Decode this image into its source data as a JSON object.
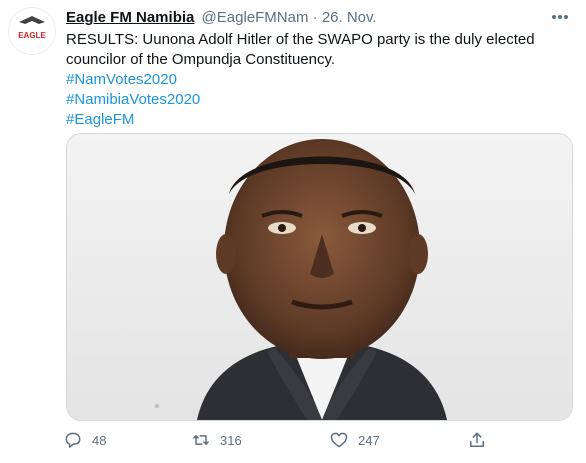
{
  "tweet": {
    "avatar_text": "EAGLE",
    "display_name": "Eagle FM Namibia",
    "handle": "@EagleFMNam",
    "separator": "·",
    "timestamp": "26. Nov.",
    "text_line": "RESULTS: Uunona Adolf Hitler of the SWAPO party is the duly elected councilor of the Ompundja Constituency.",
    "hashtags": [
      "#NamVotes2020",
      "#NamibiaVotes2020",
      "#EagleFM"
    ],
    "photo_subject": "portrait-photo",
    "counts": {
      "replies": "48",
      "retweets": "316",
      "likes": "247"
    }
  },
  "colors": {
    "link": "#1b95e0",
    "secondary": "#5b7083",
    "primary": "#0f1419",
    "border": "#cfd9de"
  },
  "icons": {
    "reply": "reply-icon",
    "retweet": "retweet-icon",
    "like": "heart-icon",
    "share": "share-icon",
    "more": "more-icon"
  }
}
